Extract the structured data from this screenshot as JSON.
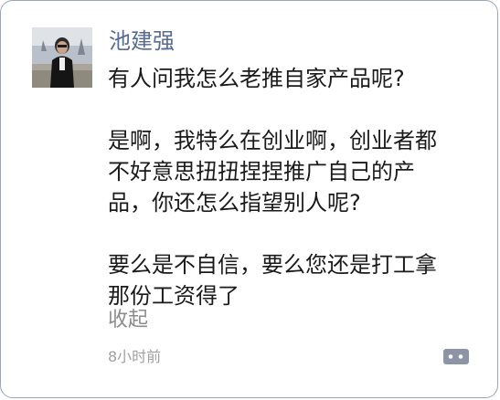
{
  "post": {
    "author": "池建强",
    "paragraphs": [
      "有人问我怎么老推自家产品呢?",
      "是啊，我特么在创业啊，创业者都\n不好意思扭扭捏捏推广自己的产\n品，你还怎么指望别人呢?",
      "要么是不自信，要么您还是打工拿\n那份工资得了"
    ],
    "collapse_label": "收起",
    "time": "8小时前"
  },
  "icons": {
    "comment": "comment-bubble-icon",
    "avatar": "avatar"
  },
  "colors": {
    "author": "#576b95",
    "text": "#1a1a1a",
    "muted": "#8c8c8c",
    "border": "#9aa6b8"
  }
}
